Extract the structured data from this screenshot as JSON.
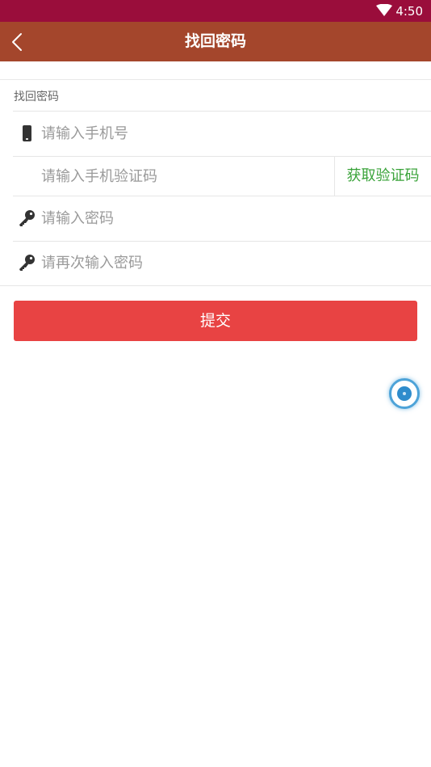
{
  "status_bar": {
    "time": "4:50",
    "wifi_icon": "wifi-icon"
  },
  "app_bar": {
    "title": "找回密码",
    "back_icon": "back-arrow-icon"
  },
  "section": {
    "label": "找回密码"
  },
  "form": {
    "phone": {
      "placeholder": "请输入手机号",
      "value": "",
      "icon": "phone-icon"
    },
    "code": {
      "placeholder": "请输入手机验证码",
      "value": "",
      "button_label": "获取验证码"
    },
    "password": {
      "placeholder": "请输入密码",
      "value": "",
      "icon": "key-icon"
    },
    "password_confirm": {
      "placeholder": "请再次输入密码",
      "value": "",
      "icon": "key-icon"
    },
    "submit_label": "提交"
  },
  "colors": {
    "status_bar": "#9a0d3b",
    "app_bar": "#a4462c",
    "submit": "#e84343",
    "code_button_text": "#3aa33a",
    "float_button": "#4da3d8"
  }
}
